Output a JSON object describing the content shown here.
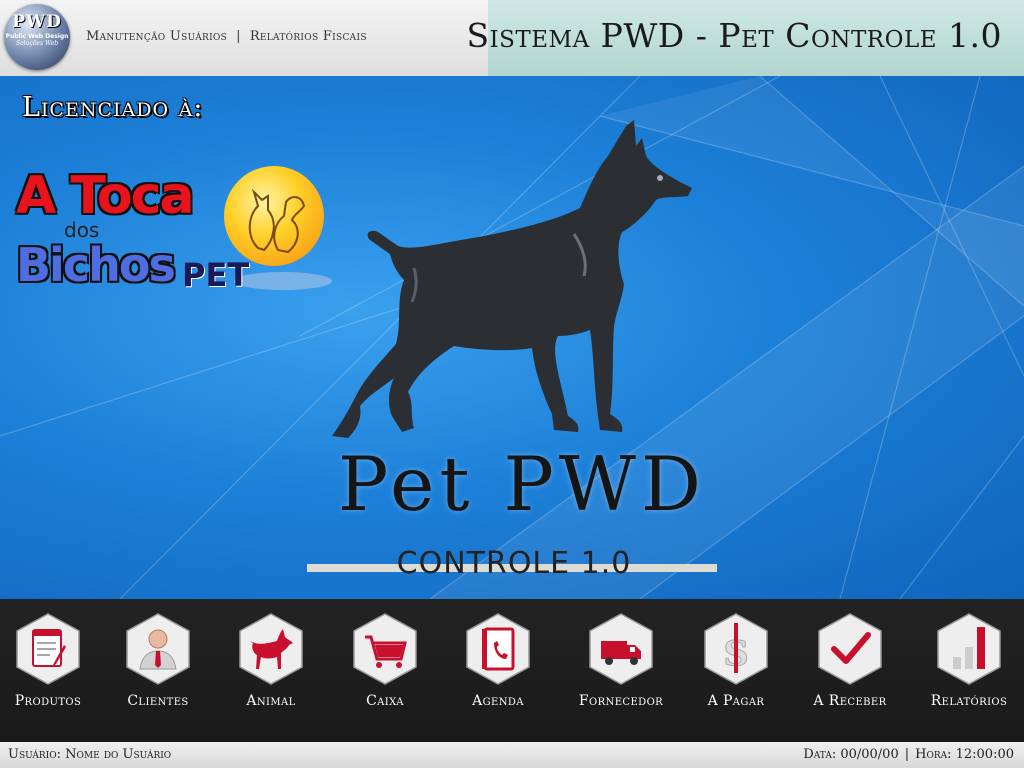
{
  "header": {
    "logo_text": "PWD",
    "logo_sub": "Public Web Design",
    "logo_sub2": "Soluções Web",
    "nav": [
      "Manutenção Usuários",
      "Relatórios Fiscais"
    ],
    "nav_separator": "|",
    "app_title": "Sistema PWD - Pet Controle 1.0"
  },
  "main": {
    "license_label": "Licenciado à:",
    "client_logo": {
      "line1": "A Toca",
      "line2": "dos",
      "line3": "Bichos",
      "line4": "PET"
    },
    "product_name": "Pet PWD",
    "product_subtitle": "CONTROLE 1.0"
  },
  "toolbar": {
    "items": [
      {
        "label": "Produtos",
        "icon": "notepad-pencil-icon"
      },
      {
        "label": "Clientes",
        "icon": "businessman-icon"
      },
      {
        "label": "Animal",
        "icon": "dog-icon"
      },
      {
        "label": "Caixa",
        "icon": "shopping-cart-icon"
      },
      {
        "label": "Agenda",
        "icon": "phone-book-icon"
      },
      {
        "label": "Fornecedor",
        "icon": "truck-icon"
      },
      {
        "label": "A Pagar",
        "icon": "dollar-icon"
      },
      {
        "label": "A Receber",
        "icon": "checkmark-icon"
      },
      {
        "label": "Relatórios",
        "icon": "bar-chart-icon"
      }
    ]
  },
  "statusbar": {
    "user": "Usuário: Nome do Usuário",
    "date": "Data: 00/00/00",
    "separator": "|",
    "time": "Hora: 12:00:00"
  },
  "colors": {
    "background_blue": "#1a7ad4",
    "header_title_bg": "#c3e0da",
    "toolbar_bg": "#1f1f1f",
    "accent_red": "#c8102e"
  }
}
